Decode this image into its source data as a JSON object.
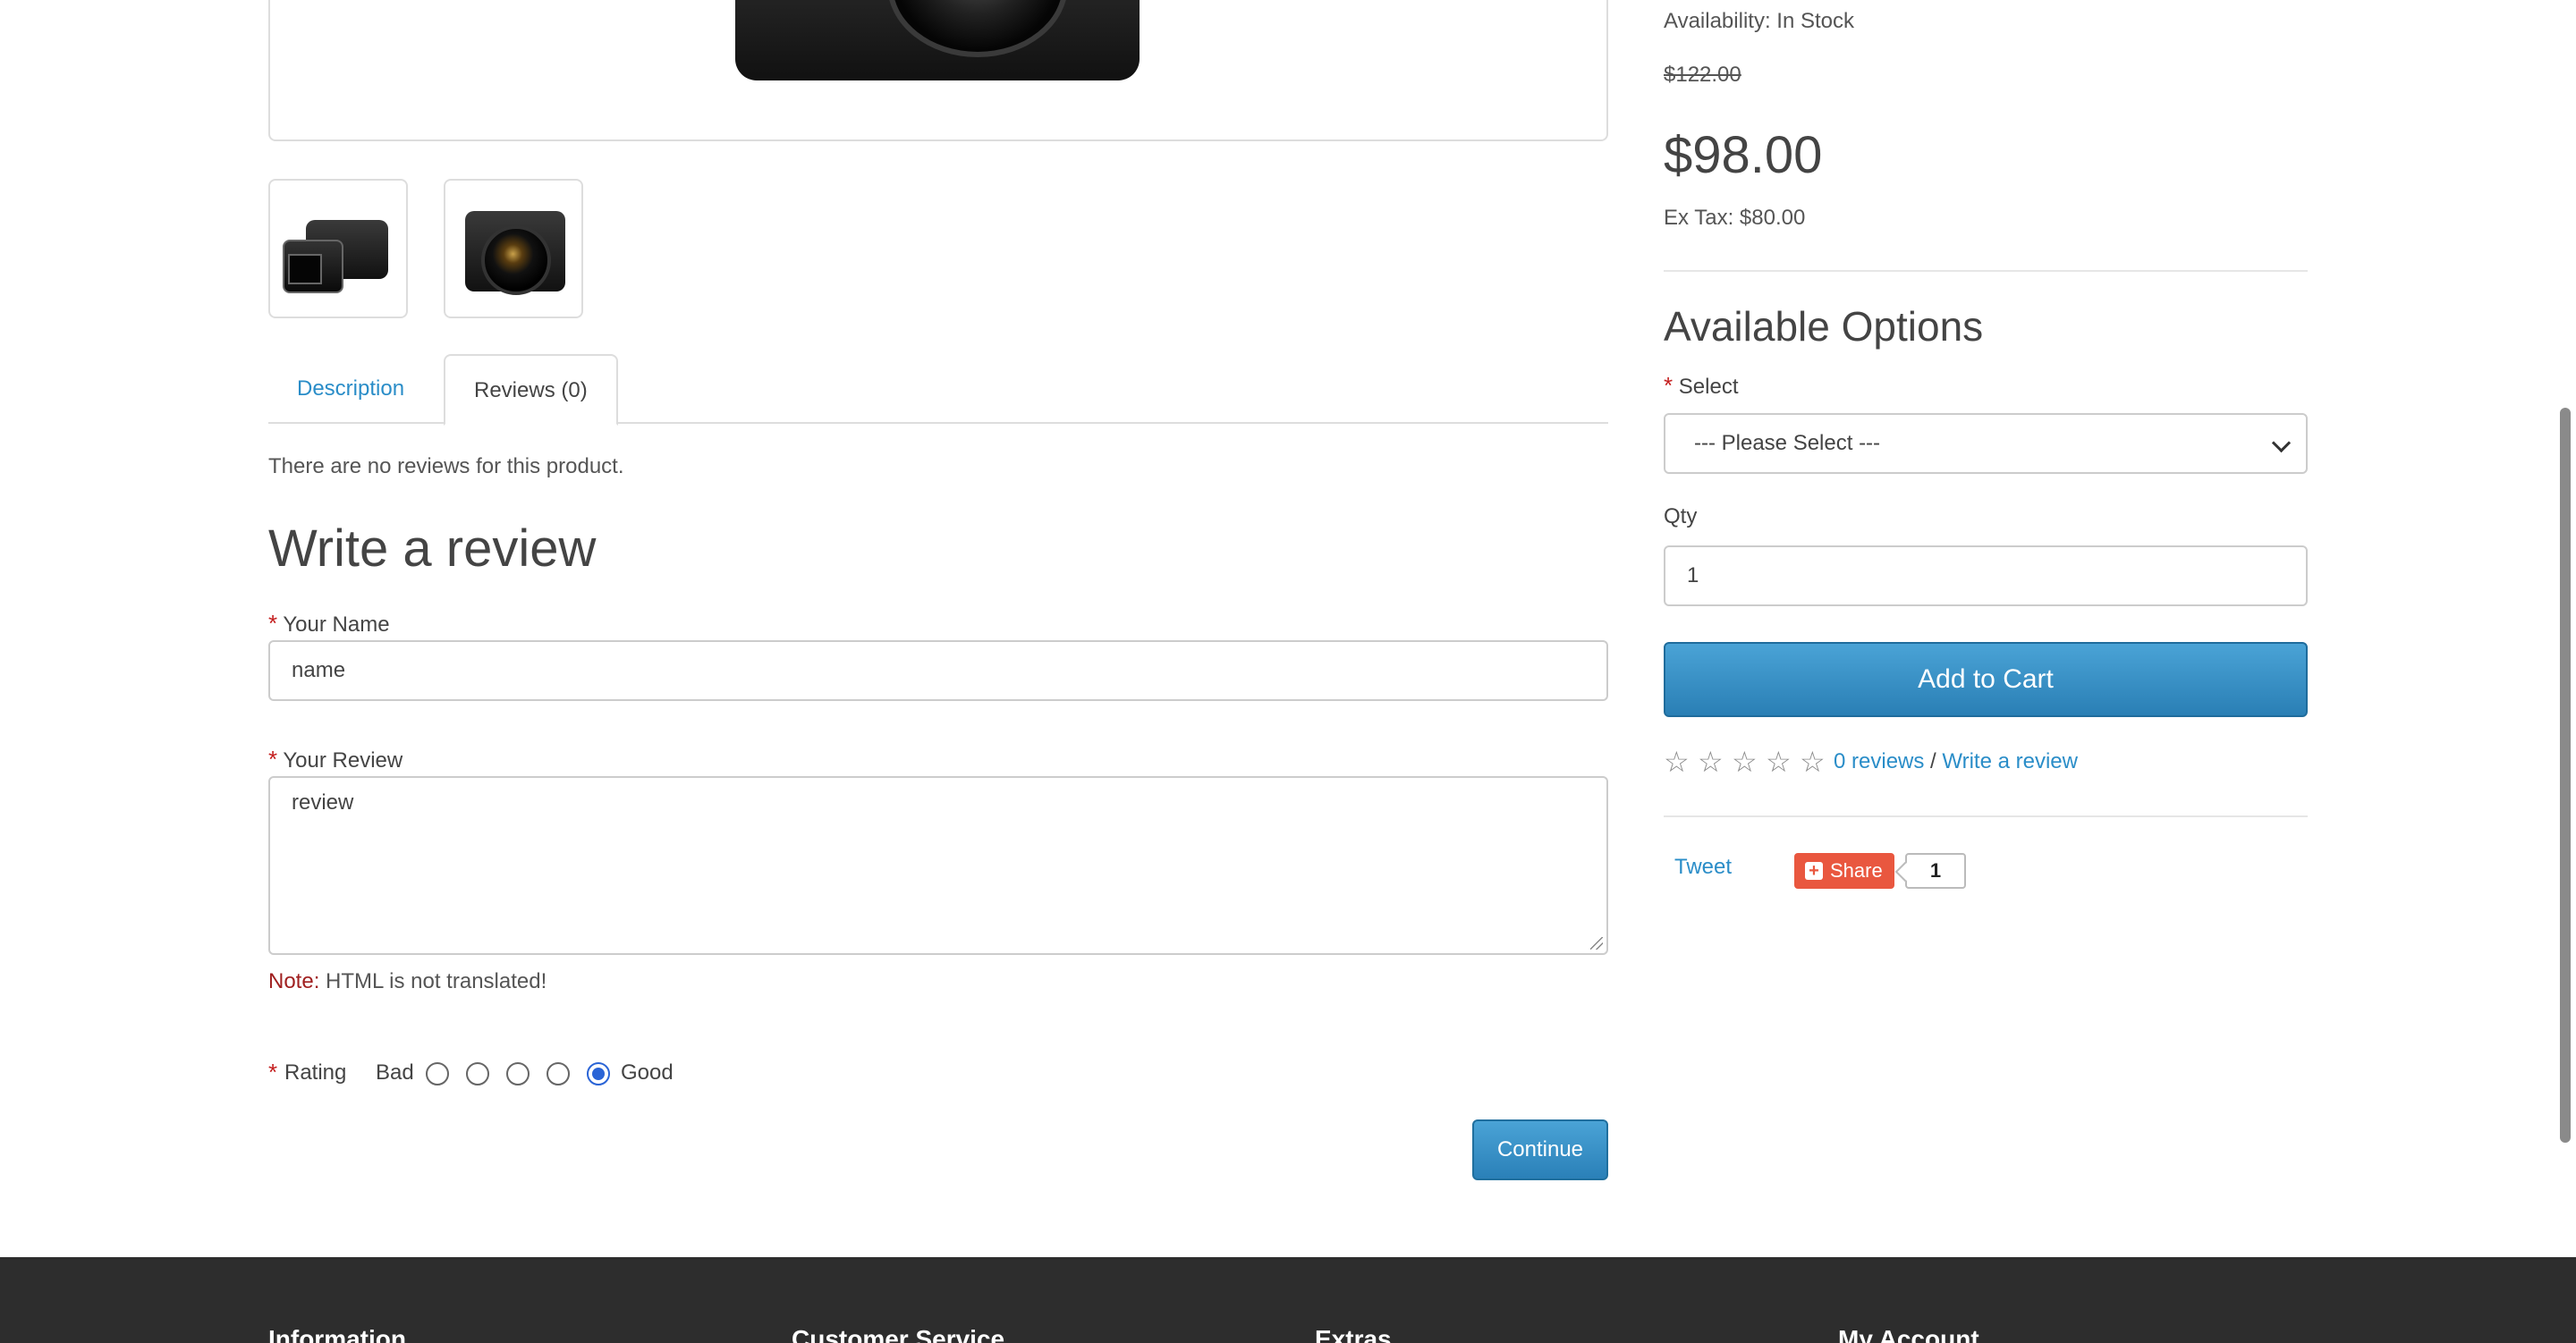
{
  "product": {
    "availability": "Availability: In Stock",
    "old_price": "$122.00",
    "price": "$98.00",
    "ex_tax": "Ex Tax: $80.00"
  },
  "tabs": [
    {
      "label": "Description",
      "active": false
    },
    {
      "label": "Reviews (0)",
      "active": true
    }
  ],
  "reviews": {
    "empty_message": "There are no reviews for this product."
  },
  "review_form": {
    "heading": "Write a review",
    "required_mark": "*",
    "name_label": "Your Name",
    "name_value": "name",
    "review_label": "Your Review",
    "review_value": "review",
    "note_label": "Note:",
    "note_text": " HTML is not translated!",
    "rating_label": "Rating",
    "rating_bad": "Bad",
    "rating_good": "Good",
    "rating_selected": 5,
    "continue_label": "Continue"
  },
  "options": {
    "heading": "Available Options",
    "select_label": "Select",
    "select_value": "--- Please Select ---",
    "qty_label": "Qty",
    "qty_value": "1",
    "add_to_cart_label": "Add to Cart"
  },
  "rating_summary": {
    "stars_filled": 0,
    "stars_total": 5,
    "reviews_link": "0 reviews",
    "separator": "/",
    "write_review_link": "Write a review"
  },
  "social": {
    "tweet_label": "Tweet",
    "share_label": "Share",
    "share_count": "1"
  },
  "footer": {
    "columns": [
      "Information",
      "Customer Service",
      "Extras",
      "My Account"
    ]
  },
  "colors": {
    "link": "#2a8dc8",
    "button": "#2a80b8",
    "required": "#c41e1e",
    "footer_bg": "#2d2d2d",
    "share": "#e9573f"
  }
}
